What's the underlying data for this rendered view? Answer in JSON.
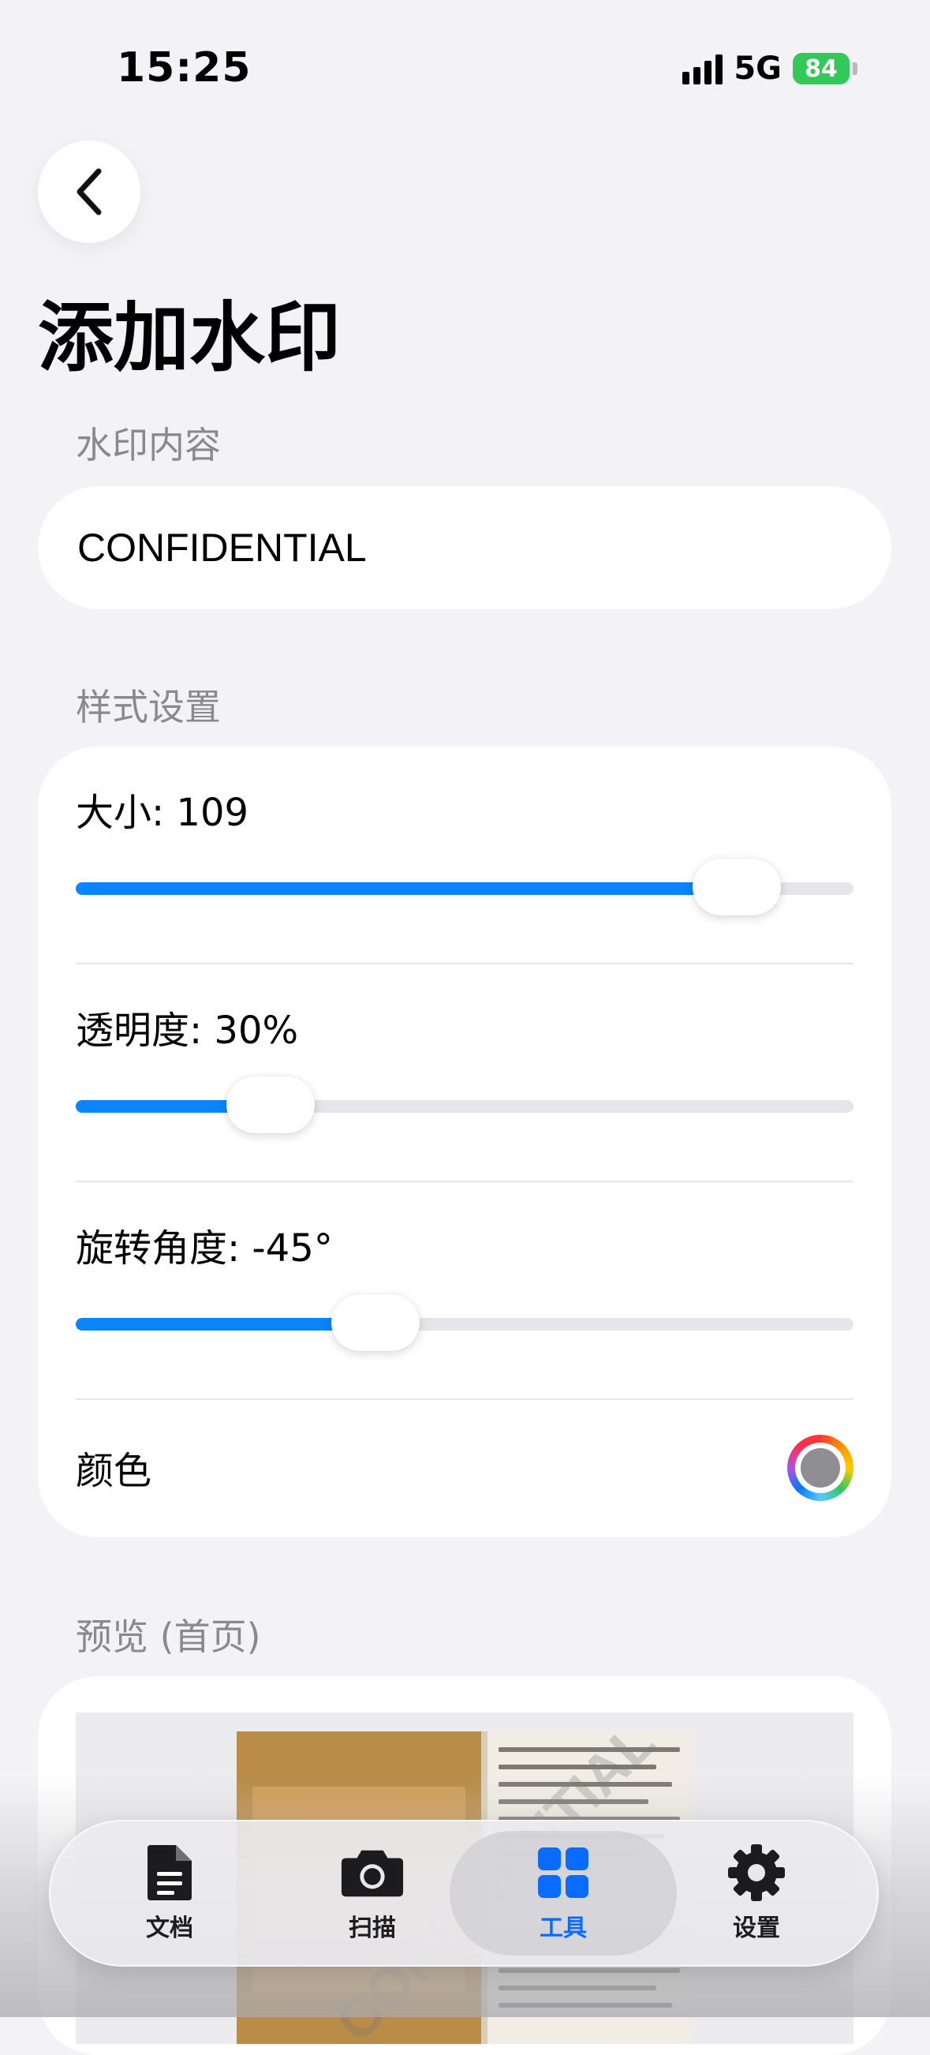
{
  "status_bar": {
    "time": "15:25",
    "network": "5G",
    "battery": "84"
  },
  "header": {
    "title": "添加水印"
  },
  "content_section": {
    "label": "水印内容",
    "value": "CONFIDENTIAL"
  },
  "style_section": {
    "label": "样式设置",
    "size": {
      "label": "大小: 109",
      "fraction": 0.85
    },
    "opacity": {
      "label": "透明度: 30%",
      "fraction": 0.25
    },
    "rotation": {
      "label": "旋转角度: -45°",
      "fraction": 0.385
    },
    "color": {
      "label": "颜色",
      "value": "#8e8e93"
    }
  },
  "preview_section": {
    "label": "预览 (首页)",
    "watermark": "CONFIDENTIAL"
  },
  "tabs": [
    {
      "label": "文档",
      "icon": "document-icon",
      "active": false
    },
    {
      "label": "扫描",
      "icon": "camera-icon",
      "active": false
    },
    {
      "label": "工具",
      "icon": "grid-icon",
      "active": true
    },
    {
      "label": "设置",
      "icon": "gear-icon",
      "active": false
    }
  ],
  "colors": {
    "accent": "#0a84ff",
    "active_tab": "#0a6cff",
    "background": "#f2f2f7"
  }
}
